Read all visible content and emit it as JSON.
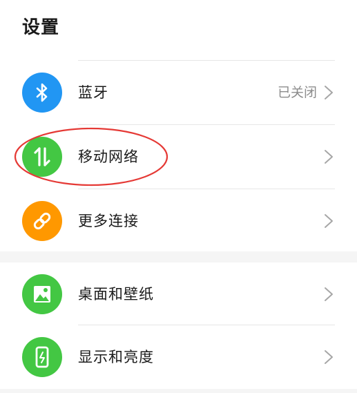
{
  "page": {
    "title": "设置"
  },
  "items": [
    {
      "label": "蓝牙",
      "status": "已关闭",
      "icon": "bluetooth-icon",
      "color": "#2196f3"
    },
    {
      "label": "移动网络",
      "status": "",
      "icon": "mobile-data-icon",
      "color": "#43c743"
    },
    {
      "label": "更多连接",
      "status": "",
      "icon": "link-icon",
      "color": "#ff9800"
    },
    {
      "label": "桌面和壁纸",
      "status": "",
      "icon": "wallpaper-icon",
      "color": "#43c743"
    },
    {
      "label": "显示和亮度",
      "status": "",
      "icon": "display-icon",
      "color": "#43c743"
    }
  ],
  "annotation": {
    "color": "#e53935"
  }
}
